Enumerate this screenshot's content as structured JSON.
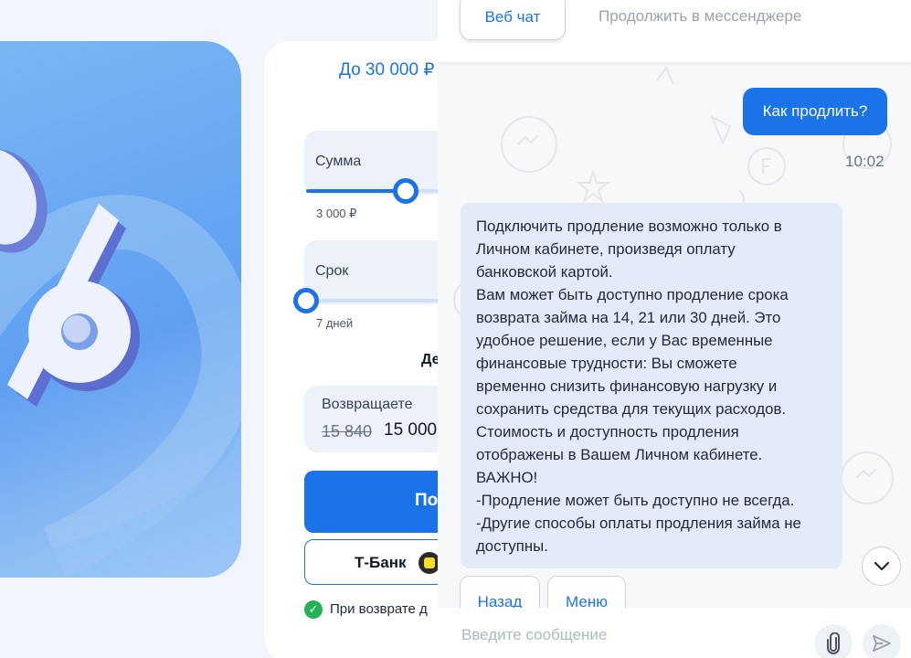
{
  "calculator": {
    "amount_max": "До 30 000 ₽",
    "amount_label": "Сумма",
    "amount_min": "3 000 ₽",
    "amount_slider_fraction": 0.55,
    "term_label": "Срок",
    "term_min": "7 дней",
    "term_slider_fraction": 0.0,
    "term_caption": "Де",
    "return_label": "Возвращаете",
    "return_old": "15 840",
    "return_new": "15 000",
    "submit_label": "По",
    "tbank_label": "Т-Банк",
    "return_note": "При возврате д"
  },
  "chat": {
    "tabs": {
      "webchat": "Веб чат",
      "messenger": "Продолжить в мессенджере"
    },
    "user_message": {
      "text": "Как продлить?",
      "time": "10:02"
    },
    "bot_message": {
      "lines": [
        "Подключить продление возможно только в",
        "Личном кабинете, произведя оплату",
        "банковской картой.",
        "Вам может быть доступно продление срока",
        "возврата займа на 14, 21 или 30 дней. Это",
        "удобное решение, если у Вас временные",
        "финансовые трудности: Вы сможете",
        "временно снизить финансовую нагрузку и",
        "сохранить средства для текущих расходов.",
        "Стоимость и доступность продления",
        "отображены в Вашем Личном кабинете.",
        "ВАЖНО!",
        "-Продление может быть доступно не всегда.",
        "-Другие способы оплаты продления займа не",
        "доступны."
      ]
    },
    "quick_replies": {
      "back": "Назад",
      "menu": "Меню"
    },
    "composer": {
      "placeholder": "Введите сообщение"
    }
  },
  "colors": {
    "accent": "#1a73e8",
    "bot_bubble": "#e4ebf8",
    "success": "#22b357"
  },
  "icons": [
    "percent-illustration",
    "check-icon",
    "tbank-logo-icon",
    "chevron-down-icon",
    "paperclip-icon",
    "send-icon"
  ]
}
